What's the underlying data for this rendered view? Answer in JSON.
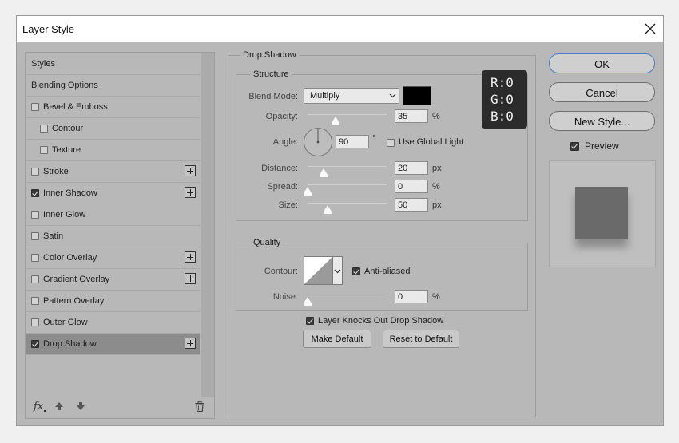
{
  "window": {
    "title": "Layer Style"
  },
  "styles_list": [
    {
      "label": "Styles",
      "checkbox": false,
      "plus": false,
      "indent": 0,
      "selected": false
    },
    {
      "label": "Blending Options",
      "checkbox": false,
      "plus": false,
      "indent": 0,
      "selected": false
    },
    {
      "label": "Bevel & Emboss",
      "checkbox": true,
      "checked": false,
      "plus": false,
      "indent": 0,
      "selected": false
    },
    {
      "label": "Contour",
      "checkbox": true,
      "checked": false,
      "plus": false,
      "indent": 1,
      "selected": false
    },
    {
      "label": "Texture",
      "checkbox": true,
      "checked": false,
      "plus": false,
      "indent": 1,
      "selected": false
    },
    {
      "label": "Stroke",
      "checkbox": true,
      "checked": false,
      "plus": true,
      "indent": 0,
      "selected": false
    },
    {
      "label": "Inner Shadow",
      "checkbox": true,
      "checked": true,
      "plus": true,
      "indent": 0,
      "selected": false
    },
    {
      "label": "Inner Glow",
      "checkbox": true,
      "checked": false,
      "plus": false,
      "indent": 0,
      "selected": false
    },
    {
      "label": "Satin",
      "checkbox": true,
      "checked": false,
      "plus": false,
      "indent": 0,
      "selected": false
    },
    {
      "label": "Color Overlay",
      "checkbox": true,
      "checked": false,
      "plus": true,
      "indent": 0,
      "selected": false
    },
    {
      "label": "Gradient Overlay",
      "checkbox": true,
      "checked": false,
      "plus": true,
      "indent": 0,
      "selected": false
    },
    {
      "label": "Pattern Overlay",
      "checkbox": true,
      "checked": false,
      "plus": false,
      "indent": 0,
      "selected": false
    },
    {
      "label": "Outer Glow",
      "checkbox": true,
      "checked": false,
      "plus": false,
      "indent": 0,
      "selected": false
    },
    {
      "label": "Drop Shadow",
      "checkbox": true,
      "checked": true,
      "plus": true,
      "indent": 0,
      "selected": true
    }
  ],
  "footer": {
    "fx_label": "fx",
    "icons": [
      "fx-icon",
      "move-up-icon",
      "move-down-icon",
      "trash-icon"
    ]
  },
  "drop_shadow": {
    "title": "Drop Shadow",
    "structure": {
      "title": "Structure",
      "blend_mode_label": "Blend Mode:",
      "blend_mode_value": "Multiply",
      "shadow_color": "#000000",
      "opacity_label": "Opacity:",
      "opacity_value": "35",
      "opacity_unit": "%",
      "opacity_level": 0.35,
      "angle_label": "Angle:",
      "angle_value": "90",
      "angle_unit": "°",
      "use_global_light_label": "Use Global Light",
      "use_global_light_checked": false,
      "distance_label": "Distance:",
      "distance_value": "20",
      "distance_unit": "px",
      "distance_level": 0.2,
      "spread_label": "Spread:",
      "spread_value": "0",
      "spread_unit": "%",
      "spread_level": 0,
      "size_label": "Size:",
      "size_value": "50",
      "size_unit": "px",
      "size_level": 0.25
    },
    "quality": {
      "title": "Quality",
      "contour_label": "Contour:",
      "anti_aliased_label": "Anti-aliased",
      "anti_aliased_checked": true,
      "noise_label": "Noise:",
      "noise_value": "0",
      "noise_unit": "%",
      "noise_level": 0
    },
    "knockout_label": "Layer Knocks Out Drop Shadow",
    "knockout_checked": true,
    "make_default_label": "Make Default",
    "reset_default_label": "Reset to Default"
  },
  "rgb_readout": {
    "r": "R:0",
    "g": "G:0",
    "b": "B:0"
  },
  "buttons": {
    "ok": "OK",
    "cancel": "Cancel",
    "new_style": "New Style..."
  },
  "preview": {
    "label": "Preview",
    "checked": true
  },
  "colors": {
    "dialog_bg": "#b8b8b8",
    "selected_row": "#8c8c8c",
    "ok_border": "#4a7fc4",
    "rgb_bg": "#2b2b2b"
  }
}
